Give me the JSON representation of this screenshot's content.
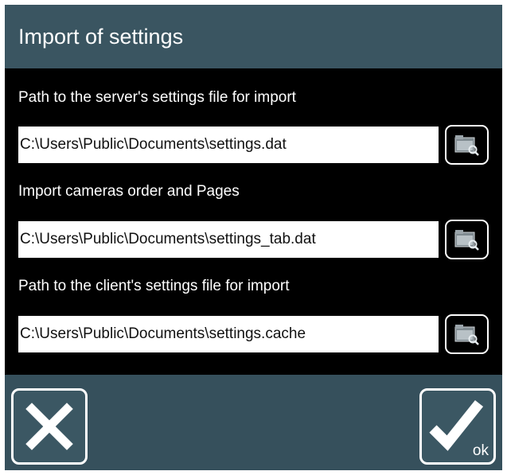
{
  "dialog": {
    "title": "Import of settings"
  },
  "fields": [
    {
      "label": "Path to the server's settings file for import",
      "value": "C:\\Users\\Public\\Documents\\settings.dat",
      "browse_icon": "folder-search-icon"
    },
    {
      "label": "Import cameras order and Pages",
      "value": "C:\\Users\\Public\\Documents\\settings_tab.dat",
      "browse_icon": "folder-search-icon"
    },
    {
      "label": "Path to the client's settings file for import",
      "value": "C:\\Users\\Public\\Documents\\settings.cache",
      "browse_icon": "folder-search-icon"
    }
  ],
  "footer": {
    "cancel_icon": "close-icon",
    "ok_icon": "checkmark-icon",
    "ok_label": "ok"
  },
  "colors": {
    "title_bar": "#3a5561",
    "panel": "#36505c",
    "content_background": "#000000",
    "field_background": "#ffffff",
    "text": "#ffffff"
  }
}
